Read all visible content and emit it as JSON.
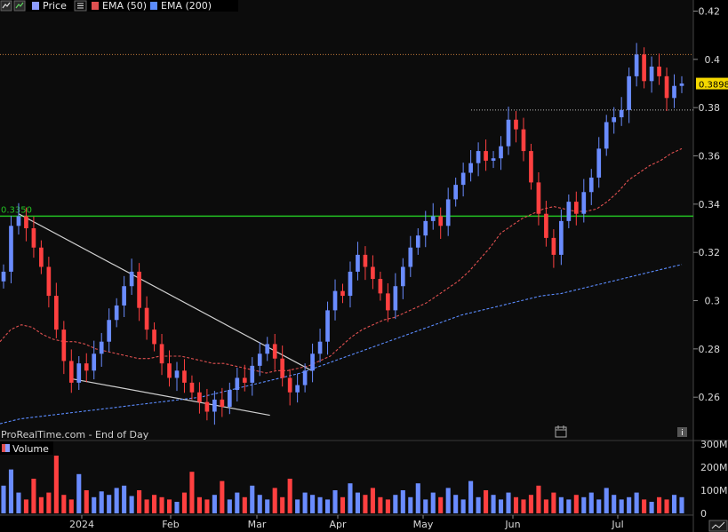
{
  "toolbar": {
    "price_label": "Price",
    "ema50_label": "EMA (50)",
    "ema200_label": "EMA (200)"
  },
  "volume_label": "Volume",
  "watermark": "ProRealTime.com - End of Day",
  "chart_data": [
    {
      "type": "candlestick",
      "title": "",
      "ylim": [
        0.2505,
        0.4235
      ],
      "yticks": [
        "0.26",
        "0.28",
        "0.3",
        "0.32",
        "0.34",
        "0.36",
        "0.38",
        "0.4",
        "0.42"
      ],
      "xticks": [
        "2024",
        "Feb",
        "Mar",
        "Apr",
        "May",
        "Jun",
        "Jul"
      ],
      "support_level": {
        "value": 0.335,
        "label": "0.3350",
        "color": "#22c022"
      },
      "current_price": {
        "value": 0.3898,
        "label": "0.3898",
        "color": "#f5d800"
      },
      "dotted_levels": [
        0.402,
        0.379
      ],
      "trend_lines": [
        {
          "from": [
            "Dec 10",
            0.336
          ],
          "to": [
            "Mar 22",
            0.271
          ]
        },
        {
          "from": [
            "Nov 30",
            0.2675
          ],
          "to": [
            "Mar 6",
            0.2525
          ]
        }
      ],
      "series": [
        {
          "name": "Price",
          "color_up": "#6a8cff",
          "color_down": "#ff4040",
          "close": [
            0.312,
            0.331,
            0.335,
            0.33,
            0.322,
            0.314,
            0.302,
            0.288,
            0.275,
            0.266,
            0.274,
            0.271,
            0.278,
            0.283,
            0.292,
            0.298,
            0.306,
            0.312,
            0.297,
            0.288,
            0.282,
            0.274,
            0.268,
            0.271,
            0.266,
            0.262,
            0.258,
            0.254,
            0.259,
            0.256,
            0.263,
            0.268,
            0.266,
            0.273,
            0.278,
            0.282,
            0.276,
            0.268,
            0.262,
            0.265,
            0.271,
            0.278,
            0.283,
            0.296,
            0.304,
            0.302,
            0.312,
            0.319,
            0.314,
            0.309,
            0.303,
            0.296,
            0.306,
            0.314,
            0.322,
            0.327,
            0.333,
            0.335,
            0.331,
            0.342,
            0.348,
            0.353,
            0.357,
            0.362,
            0.358,
            0.359,
            0.364,
            0.375,
            0.371,
            0.362,
            0.349,
            0.336,
            0.326,
            0.319,
            0.333,
            0.341,
            0.336,
            0.345,
            0.351,
            0.363,
            0.374,
            0.376,
            0.379,
            0.393,
            0.402,
            0.391,
            0.397,
            0.393,
            0.384,
            0.389,
            0.39
          ],
          "ema_50": [
            0.283,
            0.288,
            0.29,
            0.289,
            0.286,
            0.284,
            0.283,
            0.283,
            0.282,
            0.28,
            0.279,
            0.278,
            0.277,
            0.276,
            0.276,
            0.277,
            0.277,
            0.277,
            0.276,
            0.275,
            0.274,
            0.274,
            0.273,
            0.272,
            0.271,
            0.27,
            0.271,
            0.271,
            0.272,
            0.273,
            0.275,
            0.277,
            0.281,
            0.285,
            0.288,
            0.29,
            0.292,
            0.293,
            0.295,
            0.297,
            0.299,
            0.302,
            0.305,
            0.308,
            0.312,
            0.317,
            0.322,
            0.328,
            0.331,
            0.334,
            0.336,
            0.338,
            0.339,
            0.338,
            0.337,
            0.337,
            0.338,
            0.341,
            0.345,
            0.35,
            0.353,
            0.356,
            0.358,
            0.361,
            0.363
          ],
          "ema_200": [
            0.249,
            0.251,
            0.252,
            0.253,
            0.254,
            0.255,
            0.256,
            0.257,
            0.258,
            0.259,
            0.26,
            0.262,
            0.264,
            0.266,
            0.268,
            0.27,
            0.273,
            0.276,
            0.279,
            0.282,
            0.285,
            0.288,
            0.291,
            0.294,
            0.296,
            0.298,
            0.3,
            0.302,
            0.303,
            0.305,
            0.307,
            0.309,
            0.311,
            0.313,
            0.315
          ]
        }
      ]
    },
    {
      "type": "bar",
      "title": "Volume",
      "ylim": [
        0,
        300
      ],
      "yticks": [
        "0",
        "100M",
        "200M",
        "300M"
      ],
      "values": [
        120,
        190,
        90,
        60,
        150,
        70,
        90,
        250,
        80,
        60,
        170,
        100,
        70,
        95,
        80,
        110,
        120,
        75,
        100,
        60,
        80,
        70,
        60,
        50,
        90,
        180,
        70,
        60,
        80,
        140,
        60,
        90,
        70,
        120,
        80,
        60,
        110,
        70,
        150,
        60,
        90,
        80,
        70,
        60,
        100,
        70,
        130,
        90,
        80,
        110,
        70,
        60,
        80,
        100,
        70,
        130,
        60,
        90,
        70,
        110,
        80,
        60,
        140,
        70,
        100,
        80,
        60,
        90,
        70,
        60,
        80,
        120,
        60,
        90,
        70,
        60,
        80,
        70,
        90,
        60,
        110,
        80,
        60,
        70,
        90,
        60,
        50,
        70,
        60,
        80,
        70
      ]
    }
  ]
}
